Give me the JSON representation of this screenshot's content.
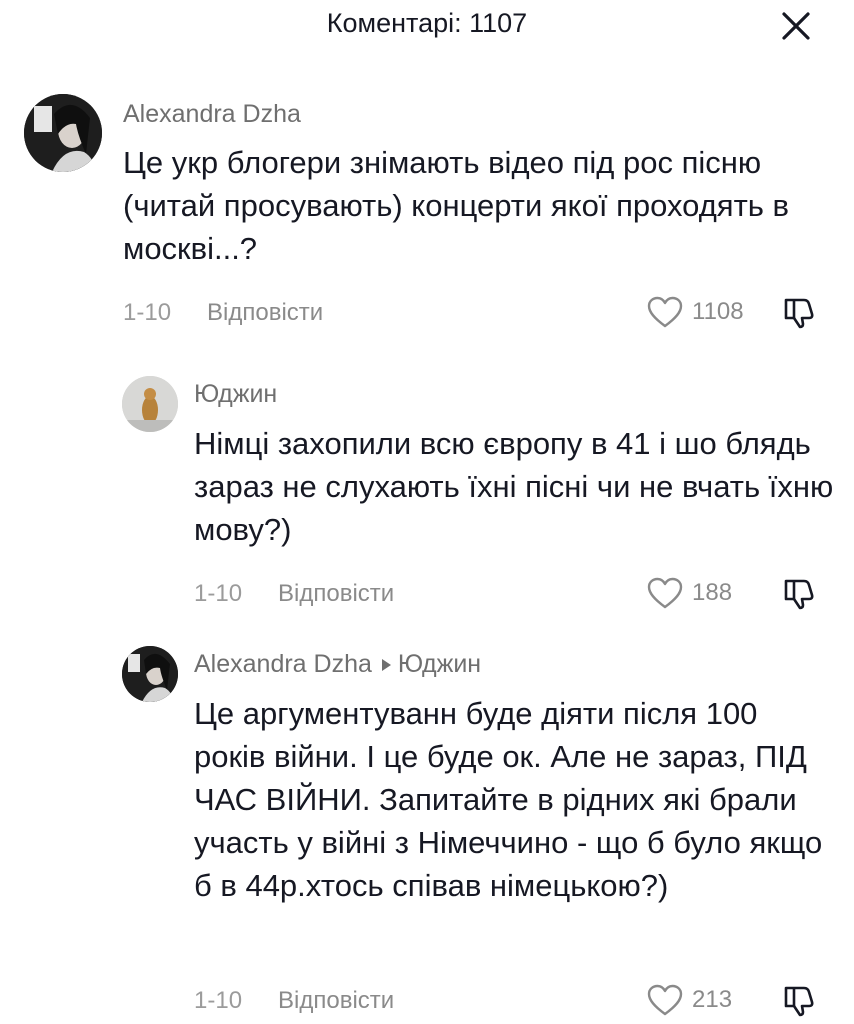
{
  "header": {
    "title": "Коментарі: 1107",
    "close_icon": "close-icon"
  },
  "comments": [
    {
      "author": "Alexandra Dzha",
      "text": "Це укр блогери знімають відео під рос пісню (читай просувають) концерти якої проходять в москві...?",
      "date": "1-10",
      "reply_label": "Відповісти",
      "likes": "1108"
    },
    {
      "author": "Юджин",
      "text": "Німці захопили всю європу в 41 і шо блядь зараз не слухають їхні пісні чи не вчать їхню мову?)",
      "date": "1-10",
      "reply_label": "Відповісти",
      "likes": "188"
    },
    {
      "author": "Alexandra Dzha",
      "reply_to": "Юджин",
      "text": "Це аргументуванн буде діяти після 100 років війни. І це буде ок. Але не зараз, ПІД ЧАС ВІЙНИ. Запитайте в рідних які брали участь у війні з Німеччино - що б було якщо б в 44р.хтось співав німецькою?)",
      "date": "1-10",
      "reply_label": "Відповісти",
      "likes": "213"
    }
  ],
  "icons": {
    "like": "heart-outline-icon",
    "dislike": "thumbs-down-icon",
    "reply_arrow": "triangle-right-icon"
  },
  "colors": {
    "text": "#161823",
    "muted": "#8a8a8a",
    "name": "#6f6f6f"
  }
}
